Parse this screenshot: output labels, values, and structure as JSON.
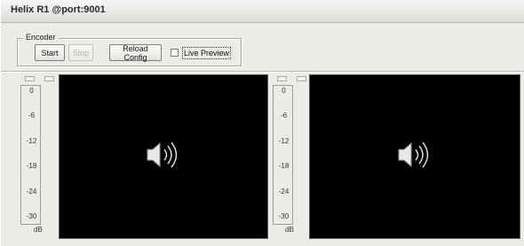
{
  "window": {
    "title": "Helix R1 @port:9001"
  },
  "encoder": {
    "group_label": "Encoder",
    "start_label": "Start",
    "stop_label": "Stop",
    "reload_label": "Reload Config",
    "live_preview_label": "Live Preview",
    "live_preview_checked": false
  },
  "meters": {
    "left": {
      "ticks": [
        "0",
        "-6",
        "-12",
        "-18",
        "-24",
        "-30"
      ],
      "unit": "dB"
    },
    "right": {
      "ticks": [
        "0",
        "-6",
        "-12",
        "-18",
        "-24",
        "-30"
      ],
      "unit": "dB"
    }
  },
  "previews": {
    "left": {
      "icon": "speaker-icon",
      "background": "#000000"
    },
    "right": {
      "icon": "speaker-icon",
      "background": "#000000"
    }
  }
}
